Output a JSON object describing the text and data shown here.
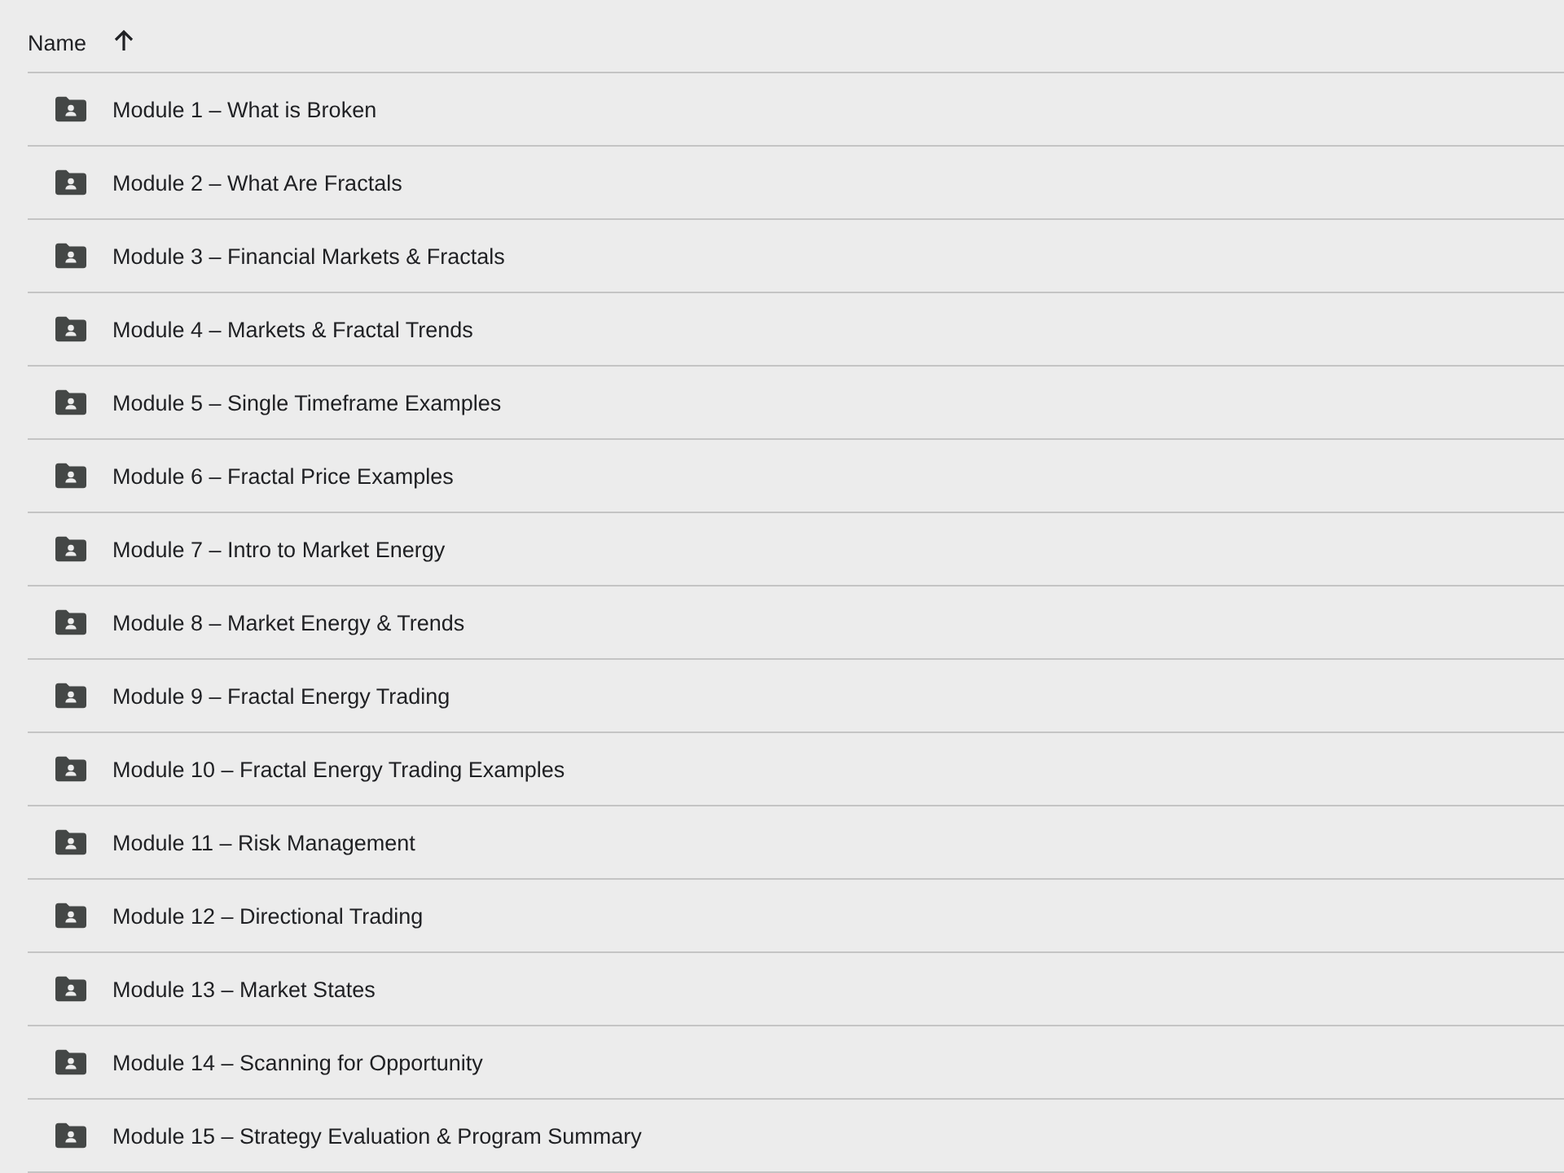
{
  "header": {
    "column": "Name",
    "ascending": true
  },
  "rows": [
    {
      "name": "Module 1 – What is Broken"
    },
    {
      "name": "Module 2 – What Are Fractals"
    },
    {
      "name": "Module 3 – Financial Markets & Fractals"
    },
    {
      "name": "Module 4 – Markets & Fractal Trends"
    },
    {
      "name": "Module 5 – Single Timeframe Examples"
    },
    {
      "name": "Module 6 – Fractal Price Examples"
    },
    {
      "name": "Module 7 – Intro to Market Energy"
    },
    {
      "name": "Module 8 – Market Energy & Trends"
    },
    {
      "name": "Module 9 – Fractal Energy Trading"
    },
    {
      "name": "Module 10 – Fractal Energy Trading Examples"
    },
    {
      "name": "Module 11 – Risk Management"
    },
    {
      "name": "Module 12 – Directional Trading"
    },
    {
      "name": "Module 13 – Market States"
    },
    {
      "name": "Module 14 – Scanning for Opportunity"
    },
    {
      "name": "Module 15 – Strategy Evaluation & Program Summary"
    }
  ]
}
